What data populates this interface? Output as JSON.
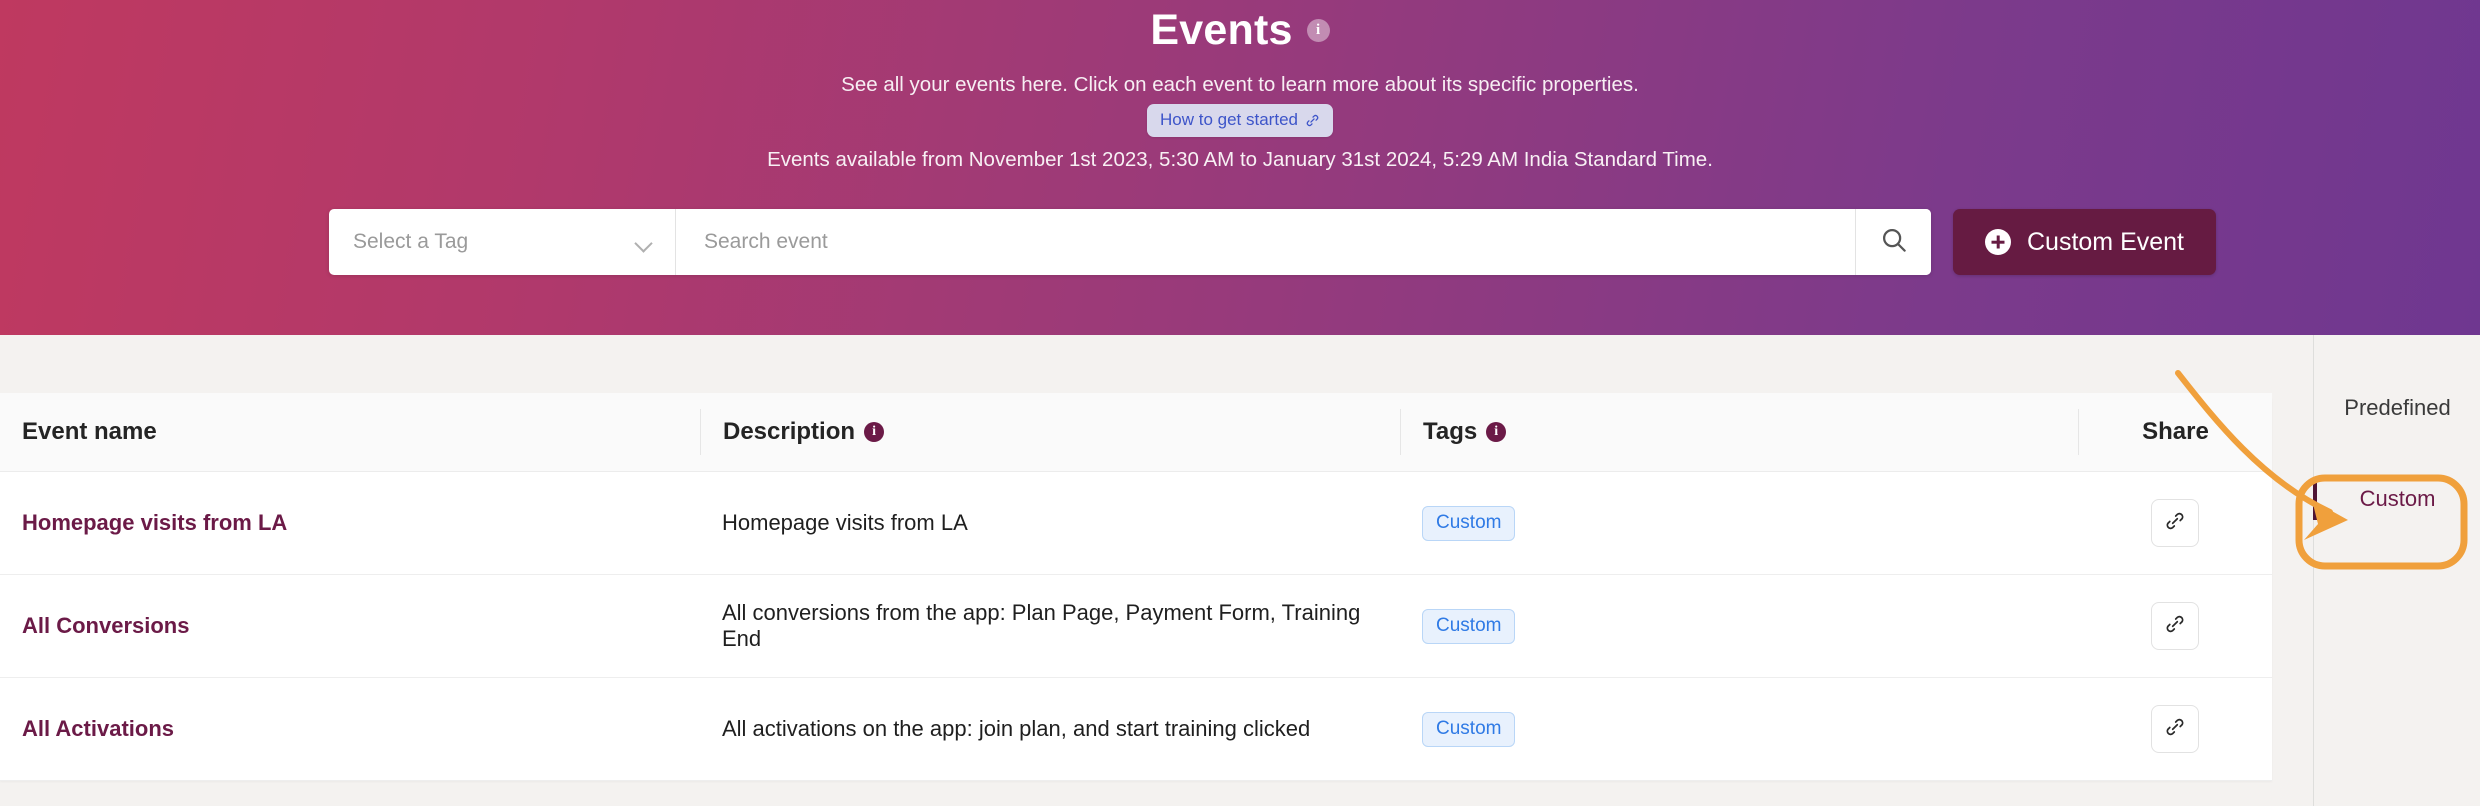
{
  "hero": {
    "title": "Events",
    "title_info_icon": "info-icon",
    "subtitle": "See all your events here. Click on each event to learn more about its specific properties.",
    "howto_label": "How to get started",
    "howto_icon": "link-icon",
    "date_range": "Events available from November 1st 2023, 5:30 AM  to January 31st 2024, 5:29 AM India Standard Time."
  },
  "search": {
    "tag_placeholder": "Select a Tag",
    "tag_chevron_icon": "chevron-down-icon",
    "event_placeholder": "Search event",
    "event_value": "",
    "search_icon": "search-icon",
    "custom_event_label": "Custom Event",
    "custom_event_icon": "plus-circle-icon"
  },
  "table": {
    "columns": [
      {
        "label": "Event name",
        "info": false
      },
      {
        "label": "Description",
        "info": true
      },
      {
        "label": "Tags",
        "info": true
      },
      {
        "label": "Share",
        "info": false
      }
    ],
    "rows": [
      {
        "name": "Homepage visits from LA",
        "description": "Homepage visits from LA",
        "tag": "Custom",
        "share_icon": "link-icon"
      },
      {
        "name": "All Conversions",
        "description": "All conversions from the app: Plan Page, Payment Form, Training End",
        "tag": "Custom",
        "share_icon": "link-icon"
      },
      {
        "name": "All Activations",
        "description": "All activations on the app: join plan, and start training clicked",
        "tag": "Custom",
        "share_icon": "link-icon"
      }
    ]
  },
  "right_panel": {
    "items": [
      {
        "label": "Predefined",
        "selected": false
      },
      {
        "label": "Custom",
        "selected": true
      }
    ]
  },
  "annotation": {
    "color": "#f0a03c",
    "target": "Custom",
    "shape": "curved-arrow-and-rounded-rect"
  },
  "colors": {
    "hero_gradient_start": "#bf3960",
    "hero_gradient_end": "#6f3790",
    "brand_purple": "#6b1a47",
    "tag_blue": "#2f7ae5",
    "link_blue": "#3d54c9",
    "annotation_orange": "#f0a03c",
    "page_background": "#f4f2f0"
  }
}
